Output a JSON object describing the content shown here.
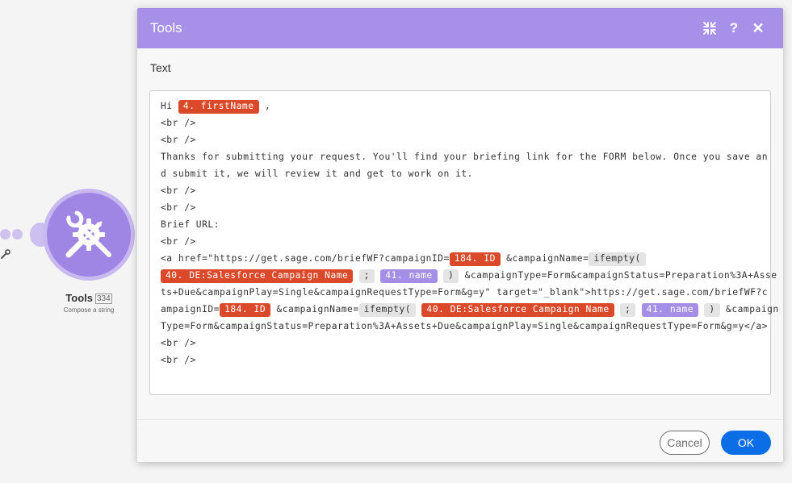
{
  "module": {
    "label": "Tools",
    "badge": "334",
    "sublabel": "Compose a string"
  },
  "dialog": {
    "title": "Tools",
    "help_label": "?",
    "close_label": "✕",
    "field_label": "Text",
    "cancel_label": "Cancel",
    "ok_label": "OK"
  },
  "editor": {
    "lines": [
      [
        {
          "t": "Hi "
        },
        {
          "p": "red",
          "t": "4. firstName"
        },
        {
          "t": " ,"
        }
      ],
      [
        {
          "t": "<br />"
        }
      ],
      [
        {
          "t": "<br />"
        }
      ],
      [
        {
          "t": "Thanks for submitting your request. You'll find your briefing link for the FORM below. Once you save an"
        }
      ],
      [
        {
          "t": "d submit it, we will review it and get to work on it."
        }
      ],
      [
        {
          "t": "<br />"
        }
      ],
      [
        {
          "t": "<br />"
        }
      ],
      [
        {
          "t": "Brief URL:"
        }
      ],
      [
        {
          "t": "<br />"
        }
      ],
      [
        {
          "t": "<a href=\"https://get.sage.com/briefWF?campaignID="
        },
        {
          "p": "red",
          "t": "184. ID"
        },
        {
          "t": " &campaignName="
        },
        {
          "p": "grey",
          "t": "ifempty("
        }
      ],
      [
        {
          "p": "red",
          "t": "40. DE:Salesforce Campaign Name"
        },
        {
          "t": " "
        },
        {
          "p": "grey",
          "t": ";"
        },
        {
          "t": " "
        },
        {
          "p": "purple",
          "t": "41. name"
        },
        {
          "t": " "
        },
        {
          "p": "grey",
          "t": ")"
        },
        {
          "t": " &campaignType=Form&campaignStatus=Preparation%3A+Asse"
        }
      ],
      [
        {
          "t": "ts+Due&campaignPlay=Single&campaignRequestType=Form&g=y\" target=\"_blank\">https://get.sage.com/briefWF?c"
        }
      ],
      [
        {
          "t": "ampaignID="
        },
        {
          "p": "red",
          "t": "184. ID"
        },
        {
          "t": " &campaignName="
        },
        {
          "p": "grey",
          "t": "ifempty("
        },
        {
          "t": " "
        },
        {
          "p": "red",
          "t": "40. DE:Salesforce Campaign Name"
        },
        {
          "t": " "
        },
        {
          "p": "grey",
          "t": ";"
        },
        {
          "t": " "
        },
        {
          "p": "purple",
          "t": "41. name"
        },
        {
          "t": " "
        },
        {
          "p": "grey",
          "t": ")"
        },
        {
          "t": " &campaign"
        }
      ],
      [
        {
          "t": "Type=Form&campaignStatus=Preparation%3A+Assets+Due&campaignPlay=Single&campaignRequestType=Form&g=y</a>"
        }
      ],
      [
        {
          "t": "<br />"
        }
      ],
      [
        {
          "t": "<br />"
        }
      ]
    ]
  },
  "icons": {
    "collapse": "collapse-icon",
    "help": "help-icon",
    "close": "close-icon",
    "module": "tools-icon",
    "settings": "wrench-icon"
  },
  "colors": {
    "header": "#a690e8",
    "pill_red": "#da4a2a",
    "pill_purple": "#a48ee6",
    "pill_grey": "#e4e4e4",
    "ok_button": "#0b6ee6"
  }
}
